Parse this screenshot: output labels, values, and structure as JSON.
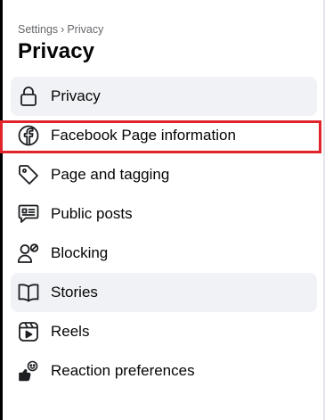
{
  "breadcrumb": {
    "parent": "Settings",
    "separator": "›",
    "current": "Privacy"
  },
  "page_title": "Privacy",
  "nav_items": [
    {
      "label": "Privacy",
      "icon": "lock-icon",
      "state": "shaded"
    },
    {
      "label": "Facebook Page information",
      "icon": "facebook-icon",
      "state": "highlighted"
    },
    {
      "label": "Page and tagging",
      "icon": "tag-icon",
      "state": "normal"
    },
    {
      "label": "Public posts",
      "icon": "chat-bubble-icon",
      "state": "normal"
    },
    {
      "label": "Blocking",
      "icon": "user-block-icon",
      "state": "normal"
    },
    {
      "label": "Stories",
      "icon": "book-icon",
      "state": "shaded"
    },
    {
      "label": "Reels",
      "icon": "reels-icon",
      "state": "normal"
    },
    {
      "label": "Reaction preferences",
      "icon": "reaction-icon",
      "state": "normal"
    }
  ],
  "colors": {
    "shaded_bg": "#f0f2f5",
    "highlight_border": "#e0242a",
    "text": "#050505",
    "muted_text": "#65676b"
  }
}
